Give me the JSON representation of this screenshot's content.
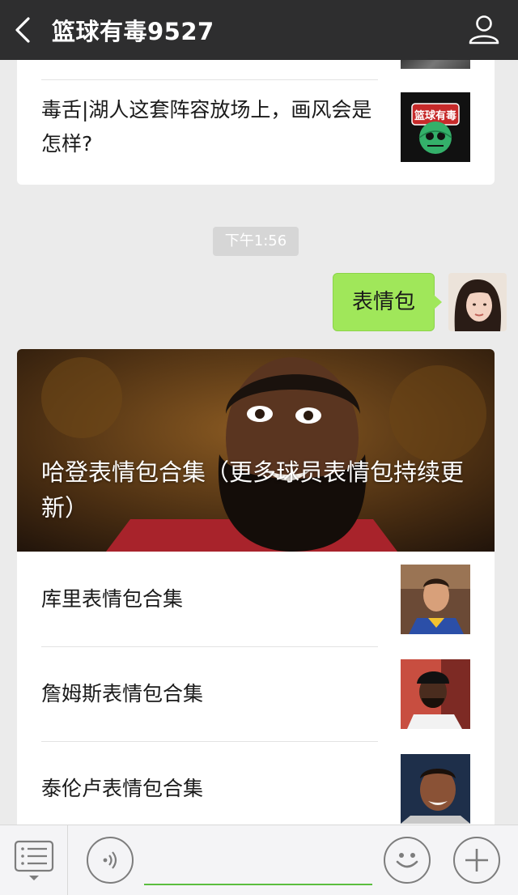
{
  "header": {
    "title": "篮球有毒9527",
    "back_icon": "chevron-left-icon",
    "profile_icon": "person-icon"
  },
  "top_card": {
    "items": [
      {
        "text": "毒舌|湖人这套阵容放场上，画风会是怎样?",
        "thumb_icon": "basketball-skull-logo"
      }
    ]
  },
  "timestamp": "下午1:56",
  "message": {
    "text": "表情包",
    "bubble_color": "#a0e75a"
  },
  "article": {
    "hero_title": "哈登表情包合集（更多球员表情包持续更新）",
    "items": [
      {
        "text": "库里表情包合集"
      },
      {
        "text": "詹姆斯表情包合集"
      },
      {
        "text": "泰伦卢表情包合集"
      }
    ]
  },
  "bottom_bar": {
    "menu_icon": "menu-list-icon",
    "voice_icon": "voice-icon",
    "emoji_icon": "emoji-icon",
    "plus_icon": "plus-icon",
    "accent": "#5bbe3f"
  }
}
